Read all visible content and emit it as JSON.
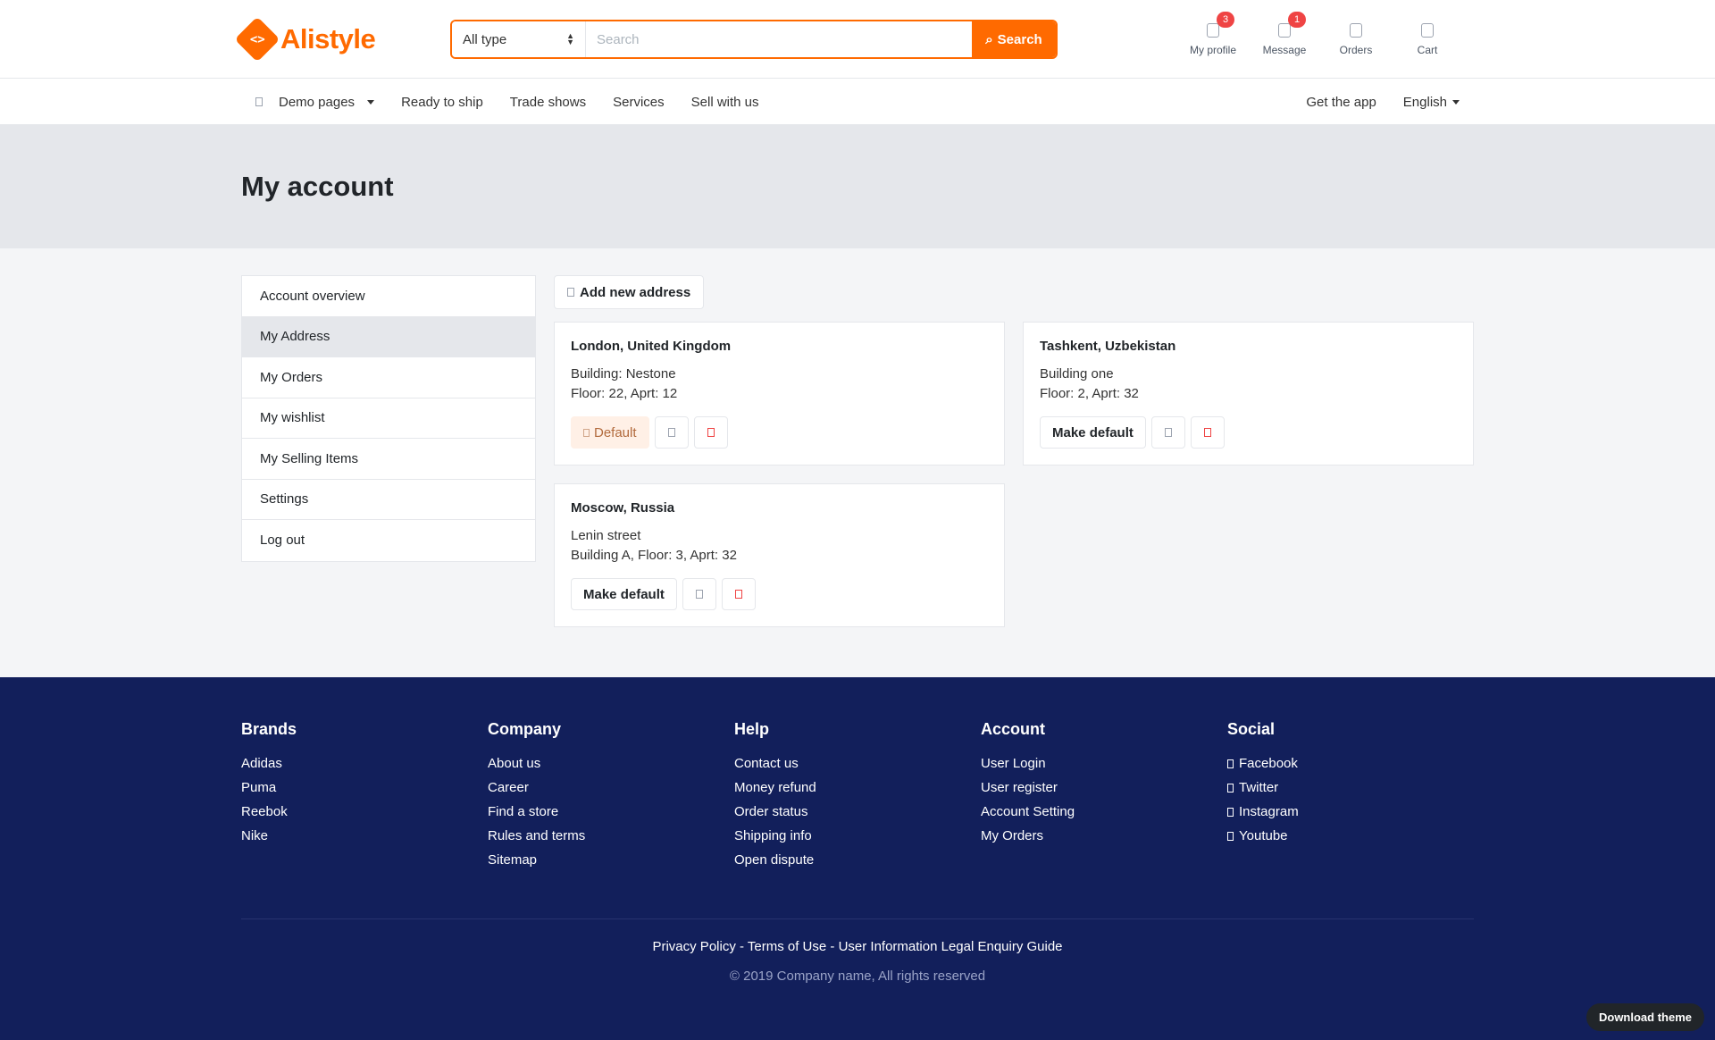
{
  "brand": {
    "name": "Alistyle",
    "logo_glyph": "<>",
    "accent": "#ff6a00"
  },
  "search": {
    "type_value": "All type",
    "placeholder": "Search",
    "button_label": "Search"
  },
  "header_icons": [
    {
      "label": "My profile",
      "badge": "3",
      "icon": "user-icon"
    },
    {
      "label": "Message",
      "badge": "1",
      "icon": "comment-icon"
    },
    {
      "label": "Orders",
      "badge": null,
      "icon": "heart-icon"
    },
    {
      "label": "Cart",
      "badge": null,
      "icon": "cart-icon"
    }
  ],
  "nav": {
    "demo_label": "Demo pages",
    "items": [
      "Ready to ship",
      "Trade shows",
      "Services",
      "Sell with us"
    ],
    "get_app": "Get the app",
    "language": "English"
  },
  "page_title": "My account",
  "sidebar": {
    "items": [
      "Account overview",
      "My Address",
      "My Orders",
      "My wishlist",
      "My Selling Items",
      "Settings",
      "Log out"
    ],
    "active_index": 1
  },
  "add_address_label": "Add new address",
  "addresses": [
    {
      "title": "London, United Kingdom",
      "line1": "Building: Nestone",
      "line2": "Floor: 22, Aprt: 12",
      "action": "Default"
    },
    {
      "title": "Tashkent, Uzbekistan",
      "line1": "Building one",
      "line2": "Floor: 2, Aprt: 32",
      "action": "Make default"
    },
    {
      "title": "Moscow, Russia",
      "line1": "Lenin street",
      "line2": "Building A, Floor: 3, Aprt: 32",
      "action": "Make default"
    }
  ],
  "footer": {
    "columns": [
      {
        "title": "Brands",
        "links": [
          "Adidas",
          "Puma",
          "Reebok",
          "Nike"
        ]
      },
      {
        "title": "Company",
        "links": [
          "About us",
          "Career",
          "Find a store",
          "Rules and terms",
          "Sitemap"
        ]
      },
      {
        "title": "Help",
        "links": [
          "Contact us",
          "Money refund",
          "Order status",
          "Shipping info",
          "Open dispute"
        ]
      },
      {
        "title": "Account",
        "links": [
          "User Login",
          "User register",
          "Account Setting",
          "My Orders"
        ]
      },
      {
        "title": "Social",
        "links": [
          "Facebook",
          "Twitter",
          "Instagram",
          "Youtube"
        ]
      }
    ],
    "legal": "Privacy Policy - Terms of Use - User Information Legal Enquiry Guide",
    "copyright": "© 2019 Company name, All rights reserved",
    "bg_color": "#121f5b"
  },
  "download_label": "Download theme"
}
